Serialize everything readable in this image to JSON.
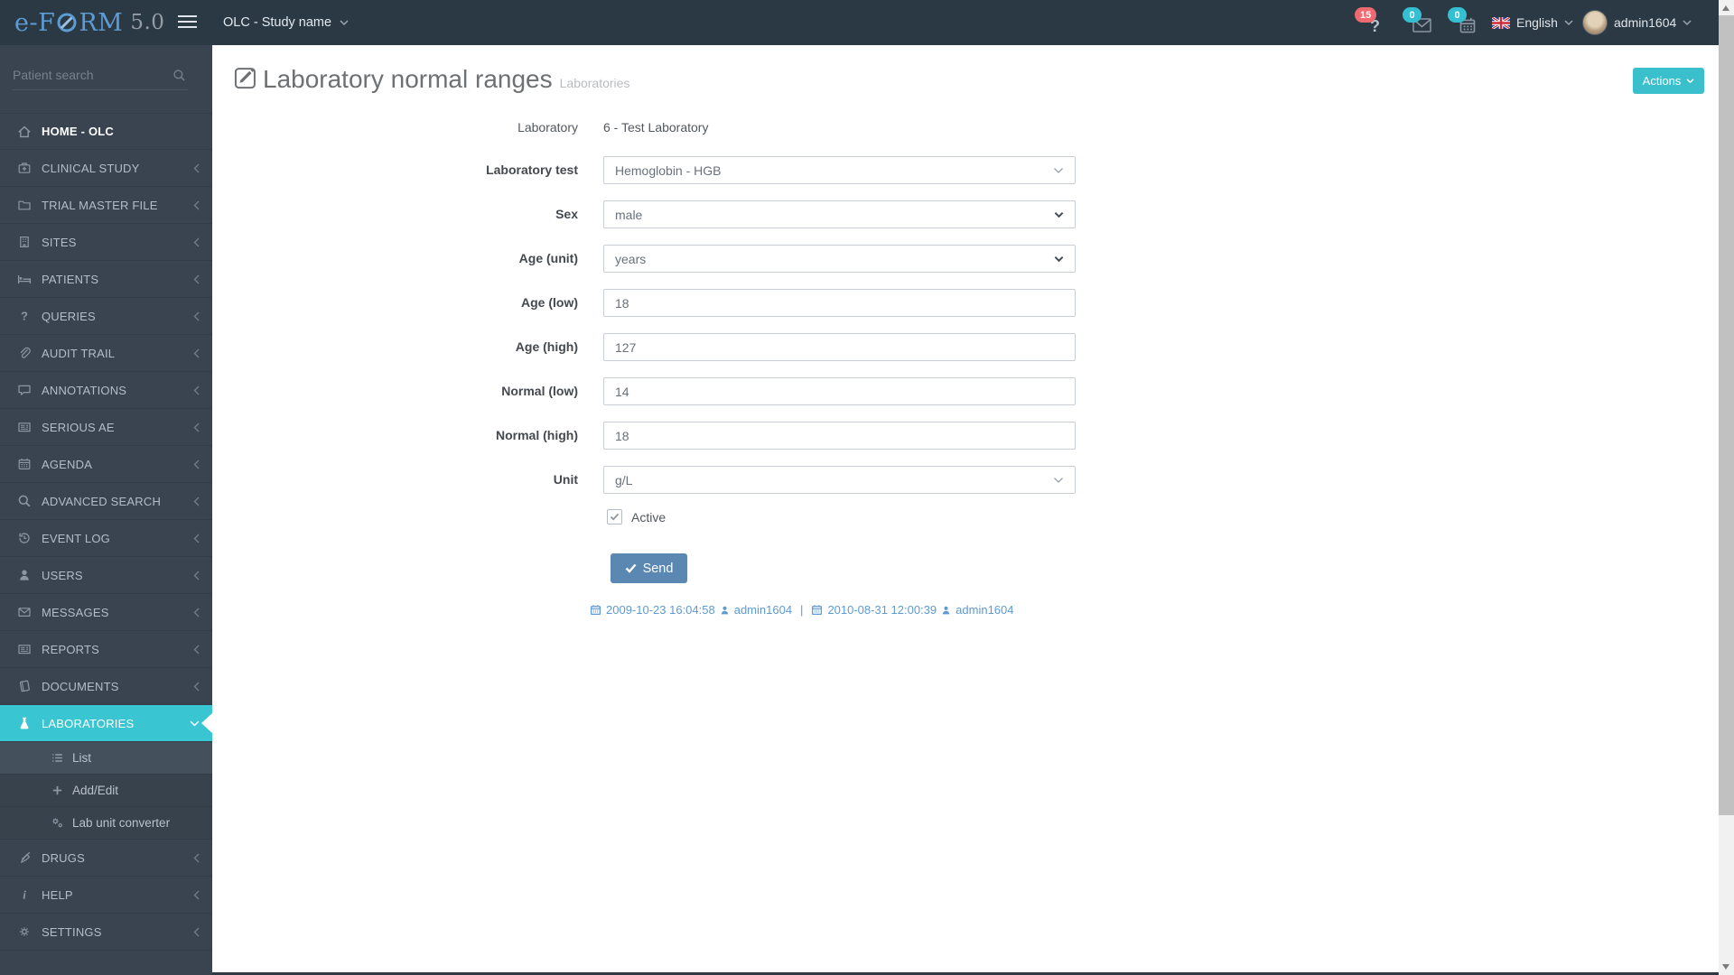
{
  "navbar": {
    "logo_prefix": "e-F",
    "logo_suffix": "RM",
    "logo_version": "5.0",
    "study_selector_label": "OLC - Study name",
    "help_badge": "15",
    "messages_badge": "0",
    "agenda_badge": "0",
    "language_label": "English",
    "username": "admin1604"
  },
  "sidebar": {
    "search_placeholder": "Patient search",
    "items": [
      {
        "label": "HOME - OLC"
      },
      {
        "label": "CLINICAL STUDY"
      },
      {
        "label": "TRIAL MASTER FILE"
      },
      {
        "label": "SITES"
      },
      {
        "label": "PATIENTS"
      },
      {
        "label": "QUERIES"
      },
      {
        "label": "AUDIT TRAIL"
      },
      {
        "label": "ANNOTATIONS"
      },
      {
        "label": "SERIOUS AE"
      },
      {
        "label": "AGENDA"
      },
      {
        "label": "ADVANCED SEARCH"
      },
      {
        "label": "EVENT LOG"
      },
      {
        "label": "USERS"
      },
      {
        "label": "MESSAGES"
      },
      {
        "label": "REPORTS"
      },
      {
        "label": "DOCUMENTS"
      },
      {
        "label": "LABORATORIES"
      },
      {
        "label": "DRUGS"
      },
      {
        "label": "HELP"
      },
      {
        "label": "SETTINGS"
      }
    ],
    "laboratories_submenu": [
      {
        "label": "List"
      },
      {
        "label": "Add/Edit"
      },
      {
        "label": "Lab unit converter"
      }
    ]
  },
  "page": {
    "title": "Laboratory normal ranges",
    "subtitle": "Laboratories",
    "actions_label": "Actions"
  },
  "form": {
    "rows": [
      {
        "label": "Laboratory",
        "value": "6 - Test Laboratory"
      },
      {
        "label": "Laboratory test",
        "value": "Hemoglobin - HGB"
      },
      {
        "label": "Sex",
        "value": "male"
      },
      {
        "label": "Age (unit)",
        "value": "years"
      },
      {
        "label": "Age (low)",
        "value": "18"
      },
      {
        "label": "Age (high)",
        "value": "127"
      },
      {
        "label": "Normal (low)",
        "value": "14"
      },
      {
        "label": "Normal (high)",
        "value": "18"
      },
      {
        "label": "Unit",
        "value": "g/L"
      }
    ],
    "active_checkbox_label": "Active",
    "send_label": "Send",
    "audit": {
      "created_date": "2009-10-23 16:04:58",
      "created_by": "admin1604",
      "separator": "|",
      "modified_date": "2010-08-31 12:00:39",
      "modified_by": "admin1604"
    }
  },
  "colors": {
    "accent_teal": "#39c5d1",
    "send_button_blue": "#5b87b3",
    "link_blue": "#5e9ad3",
    "badge_red": "#ee6a70",
    "navbar_dark": "#2b3945",
    "sidebar_dark": "#3a4450"
  }
}
